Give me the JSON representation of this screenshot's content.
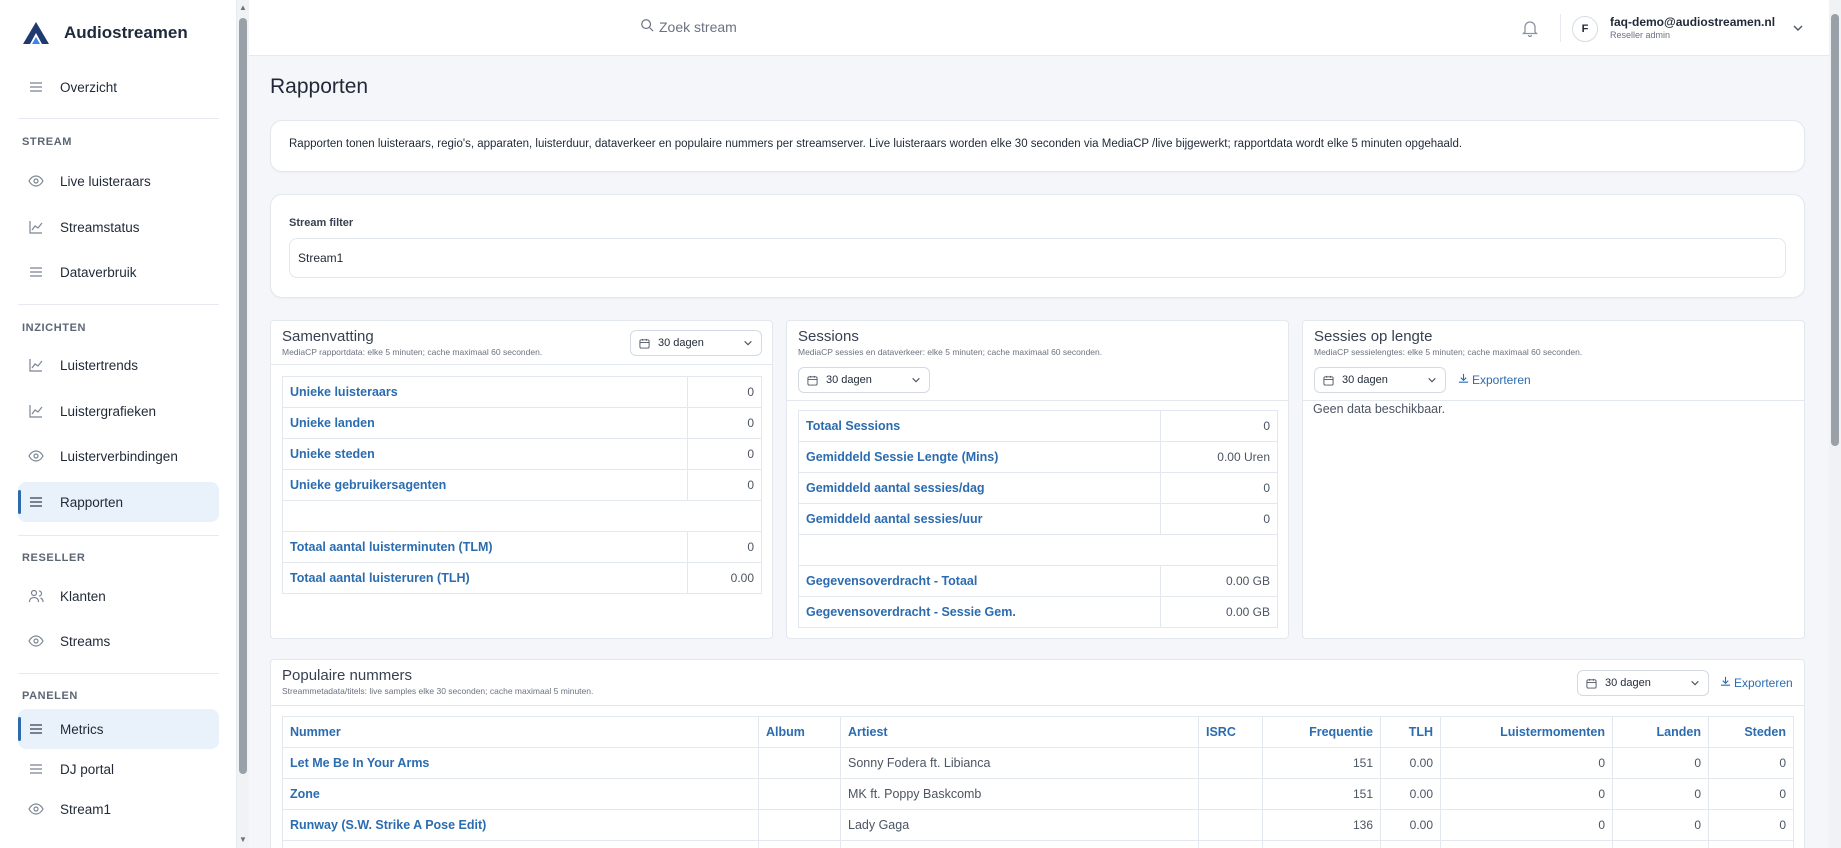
{
  "app": {
    "name": "Audiostreamen"
  },
  "sidebar": {
    "top_item": "Overzicht",
    "sections": [
      {
        "label": "STREAM",
        "items": [
          "Live luisteraars",
          "Streamstatus",
          "Dataverbruik"
        ]
      },
      {
        "label": "INZICHTEN",
        "items": [
          "Luistertrends",
          "Luistergrafieken",
          "Luisterverbindingen",
          "Rapporten"
        ]
      },
      {
        "label": "RESELLER",
        "items": [
          "Klanten",
          "Streams"
        ]
      },
      {
        "label": "PANELEN",
        "items": [
          "Metrics",
          "DJ portal",
          "Stream1"
        ]
      }
    ]
  },
  "topbar": {
    "search_placeholder": "Zoek stream",
    "avatar_initial": "F",
    "user_email": "faq-demo@audiostreamen.nl",
    "user_role": "Reseller admin"
  },
  "page": {
    "title": "Rapporten",
    "info": "Rapporten tonen luisteraars, regio's, apparaten, luisterduur, dataverkeer en populaire nummers per streamserver. Live luisteraars worden elke 30 seconden via MediaCP /live bijgewerkt; rapportdata wordt elke 5 minuten opgehaald.",
    "filter_label": "Stream filter",
    "filter_value": "Stream1"
  },
  "summary": {
    "title": "Samenvatting",
    "subtitle": "MediaCP rapportdata: elke 5 minuten; cache maximaal 60 seconden.",
    "range": "30 dagen",
    "rows": [
      {
        "label": "Unieke luisteraars",
        "value": "0"
      },
      {
        "label": "Unieke landen",
        "value": "0"
      },
      {
        "label": "Unieke steden",
        "value": "0"
      },
      {
        "label": "Unieke gebruikersagenten",
        "value": "0"
      },
      {
        "label": "",
        "value": ""
      },
      {
        "label": "Totaal aantal luisterminuten (TLM)",
        "value": "0"
      },
      {
        "label": "Totaal aantal luisteruren (TLH)",
        "value": "0.00"
      }
    ]
  },
  "sessions": {
    "title": "Sessions",
    "subtitle": "MediaCP sessies en dataverkeer: elke 5 minuten; cache maximaal 60 seconden.",
    "range": "30 dagen",
    "rows": [
      {
        "label": "Totaal Sessions",
        "value": "0"
      },
      {
        "label": "Gemiddeld Sessie Lengte (Mins)",
        "value": "0.00 Uren"
      },
      {
        "label": "Gemiddeld aantal sessies/dag",
        "value": "0"
      },
      {
        "label": "Gemiddeld aantal sessies/uur",
        "value": "0"
      },
      {
        "label": "",
        "value": ""
      },
      {
        "label": "Gegevensoverdracht - Totaal",
        "value": "0.00 GB"
      },
      {
        "label": "Gegevensoverdracht - Sessie Gem.",
        "value": "0.00 GB"
      }
    ]
  },
  "session_length": {
    "title": "Sessies op lengte",
    "subtitle": "MediaCP sessielengtes: elke 5 minuten; cache maximaal 60 seconden.",
    "range": "30 dagen",
    "export": "Exporteren",
    "empty": "Geen data beschikbaar."
  },
  "popular": {
    "title": "Populaire nummers",
    "subtitle": "Streammetadata/titels: live samples elke 30 seconden; cache maximaal 5 minuten.",
    "range": "30 dagen",
    "export": "Exporteren",
    "columns": [
      "Nummer",
      "Album",
      "Artiest",
      "ISRC",
      "Frequentie",
      "TLH",
      "Luistermomenten",
      "Landen",
      "Steden"
    ],
    "rows": [
      [
        "Let Me Be In Your Arms",
        "",
        "Sonny Fodera ft. Libianca",
        "",
        "151",
        "0.00",
        "0",
        "0",
        "0"
      ],
      [
        "Zone",
        "",
        "MK ft. Poppy Baskcomb",
        "",
        "151",
        "0.00",
        "0",
        "0",
        "0"
      ],
      [
        "Runway (S.W. Strike A Pose Edit)",
        "",
        "Lady Gaga",
        "",
        "136",
        "0.00",
        "0",
        "0",
        "0"
      ]
    ]
  },
  "colors": {
    "accent": "#2b6cb0",
    "active_bg": "#e9f1fb"
  }
}
